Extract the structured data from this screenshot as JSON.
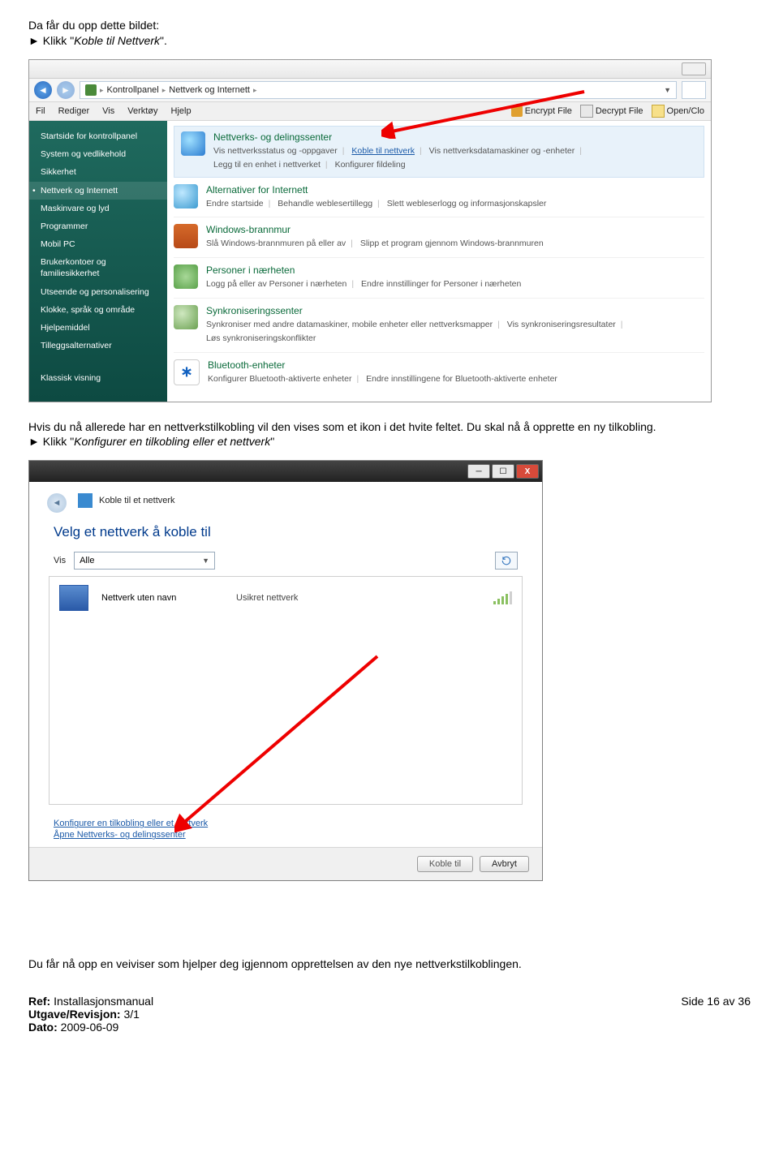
{
  "intro": {
    "line1": "Da får du opp dette bildet:",
    "line2_prefix": "► Klikk \"",
    "line2_link": "Koble til Nettverk",
    "line2_suffix": "\"."
  },
  "cp": {
    "breadcrumb": {
      "p1": "Kontrollpanel",
      "p2": "Nettverk og Internett"
    },
    "menus": [
      "Fil",
      "Rediger",
      "Vis",
      "Verktøy",
      "Hjelp"
    ],
    "toolbar": {
      "encrypt": "Encrypt File",
      "decrypt": "Decrypt File",
      "open": "Open/Clo"
    },
    "sidebar": [
      "Startside for kontrollpanel",
      "System og vedlikehold",
      "Sikkerhet",
      "Nettverk og Internett",
      "Maskinvare og lyd",
      "Programmer",
      "Mobil PC",
      "Brukerkontoer og familiesikkerhet",
      "Utseende og personalisering",
      "Klokke, språk og område",
      "Hjelpemiddel",
      "Tilleggsalternativer"
    ],
    "sidebar_bottom": "Klassisk visning",
    "groups": {
      "net": {
        "title": "Nettverks- og delingssenter",
        "l1": "Vis nettverksstatus og -oppgaver",
        "l2": "Koble til nettverk",
        "l3": "Vis nettverksdatamaskiner og -enheter",
        "l4": "Legg til en enhet i nettverket",
        "l5": "Konfigurer fildeling"
      },
      "ie": {
        "title": "Alternativer for Internett",
        "l1": "Endre startside",
        "l2": "Behandle weblesertillegg",
        "l3": "Slett webleserlogg og informasjonskapsler"
      },
      "fw": {
        "title": "Windows-brannmur",
        "l1": "Slå Windows-brannmuren på eller av",
        "l2": "Slipp et program gjennom Windows-brannmuren"
      },
      "ppl": {
        "title": "Personer i nærheten",
        "l1": "Logg på eller av Personer i nærheten",
        "l2": "Endre innstillinger for Personer i nærheten"
      },
      "sync": {
        "title": "Synkroniseringssenter",
        "l1": "Synkroniser med andre datamaskiner, mobile enheter eller nettverksmapper",
        "l2": "Vis synkroniseringsresultater",
        "l3": "Løs synkroniseringskonflikter"
      },
      "bt": {
        "title": "Bluetooth-enheter",
        "l1": "Konfigurer Bluetooth-aktiverte enheter",
        "l2": "Endre innstillingene for Bluetooth-aktiverte enheter"
      }
    }
  },
  "mid": {
    "p1": "Hvis du nå allerede har en nettverkstilkobling vil den vises som et ikon i det hvite feltet. Du skal nå å opprette en ny tilkobling.",
    "p2_prefix": "► Klikk \"",
    "p2_link": "Konfigurer en tilkobling eller et nettverk",
    "p2_suffix": "\""
  },
  "wiz": {
    "title": "Koble til et nettverk",
    "h1": "Velg et nettverk å koble til",
    "filter_label": "Vis",
    "filter_value": "Alle",
    "item_name": "Nettverk uten navn",
    "item_desc": "Usikret nettverk",
    "link1": "Konfigurer en tilkobling eller et nettverk",
    "link2": "Åpne Nettverks- og delingssenter",
    "btn_connect": "Koble til",
    "btn_cancel": "Avbryt"
  },
  "outro": "Du får nå opp en veiviser som hjelper deg igjennom opprettelsen av den nye nettverkstilkoblingen.",
  "footer": {
    "ref_lbl": "Ref:",
    "ref_val": " Installasjonsmanual",
    "rev_lbl": "Utgave/Revisjon:",
    "rev_val": " 3/1",
    "date_lbl": "Dato:",
    "date_val": " 2009-06-09",
    "page": "Side 16 av 36"
  }
}
